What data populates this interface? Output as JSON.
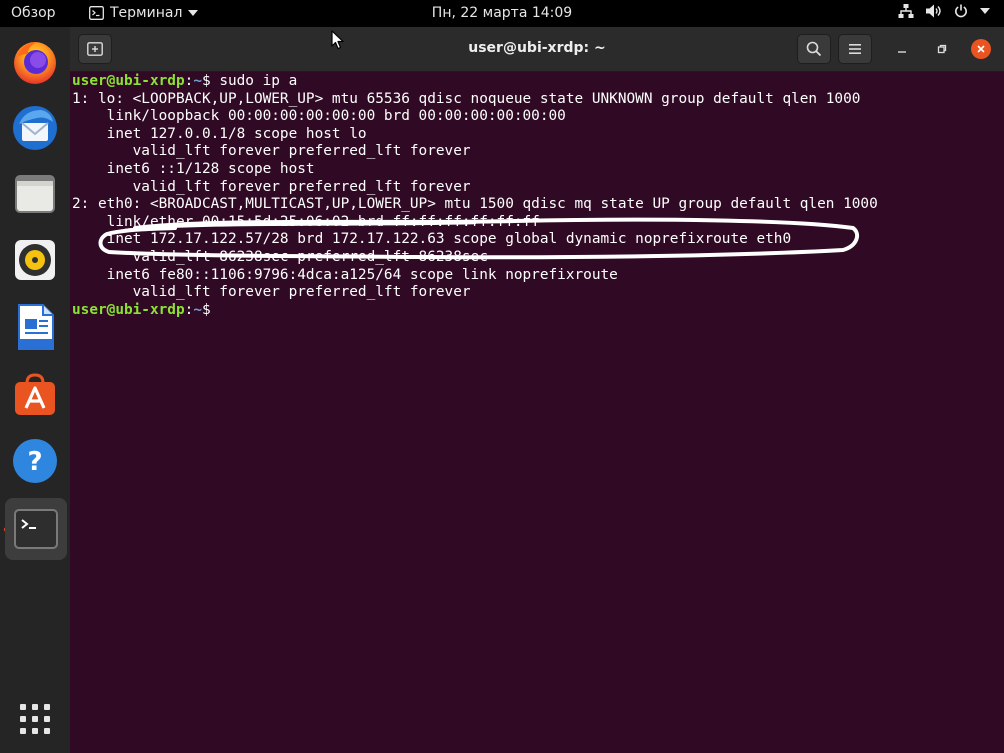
{
  "topbar": {
    "activities": "Обзор",
    "app_name": "Терминал",
    "clock": "Пн, 22 марта  14:09"
  },
  "dock": {
    "items": [
      {
        "name": "firefox"
      },
      {
        "name": "thunderbird"
      },
      {
        "name": "files"
      },
      {
        "name": "rhythmbox"
      },
      {
        "name": "libreoffice-writer"
      },
      {
        "name": "ubuntu-software"
      },
      {
        "name": "help"
      },
      {
        "name": "terminal",
        "active": true
      }
    ]
  },
  "window": {
    "title": "user@ubi-xrdp: ~"
  },
  "terminal": {
    "lines": [
      {
        "user": "user@ubi-xrdp",
        "sep": ":",
        "path": "~",
        "sym": "$",
        "cmd": " sudo ip a"
      },
      {
        "text": "1: lo: <LOOPBACK,UP,LOWER_UP> mtu 65536 qdisc noqueue state UNKNOWN group default qlen 1000"
      },
      {
        "text": "    link/loopback 00:00:00:00:00:00 brd 00:00:00:00:00:00"
      },
      {
        "text": "    inet 127.0.0.1/8 scope host lo"
      },
      {
        "text": "       valid_lft forever preferred_lft forever"
      },
      {
        "text": "    inet6 ::1/128 scope host"
      },
      {
        "text": "       valid_lft forever preferred_lft forever"
      },
      {
        "text": "2: eth0: <BROADCAST,MULTICAST,UP,LOWER_UP> mtu 1500 qdisc mq state UP group default qlen 1000"
      },
      {
        "text": "    link/ether 00:15:5d:25:06:02 brd ff:ff:ff:ff:ff:ff"
      },
      {
        "text": "    inet 172.17.122.57/28 brd 172.17.122.63 scope global dynamic noprefixroute eth0"
      },
      {
        "text": "       valid_lft 86238sec preferred_lft 86238sec"
      },
      {
        "text": "    inet6 fe80::1106:9796:4dca:a125/64 scope link noprefixroute"
      },
      {
        "text": "       valid_lft forever preferred_lft forever"
      },
      {
        "user": "user@ubi-xrdp",
        "sep": ":",
        "path": "~",
        "sym": "$",
        "cmd": ""
      }
    ]
  },
  "colors": {
    "terminal_bg": "#300a24",
    "prompt_user": "#8ae234",
    "prompt_path": "#729fcf",
    "accent": "#e95420"
  }
}
